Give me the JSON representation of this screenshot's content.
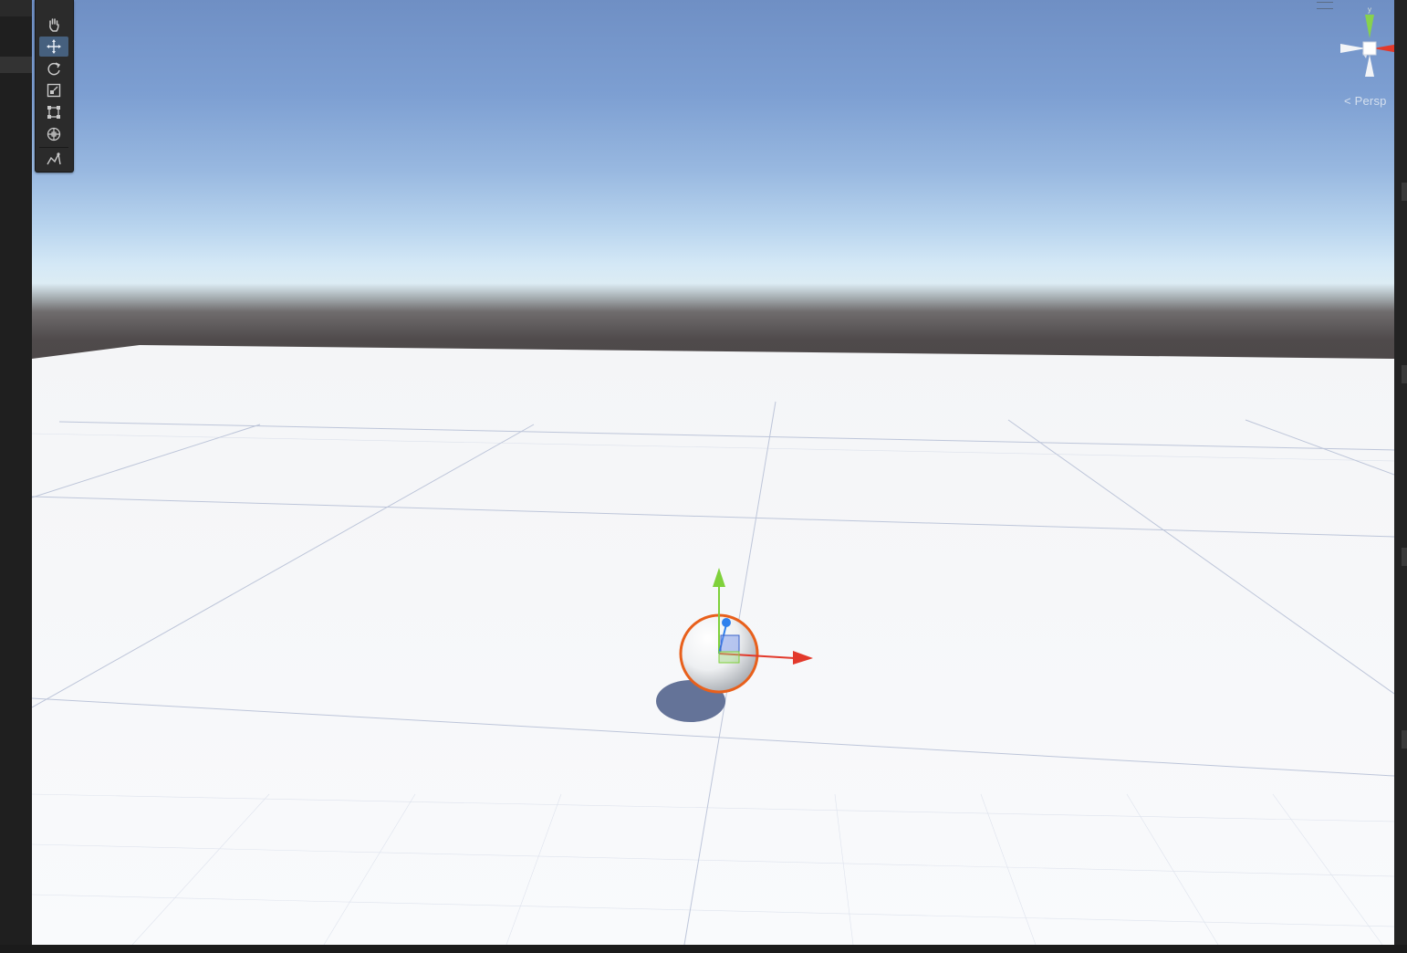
{
  "scene_view": {
    "camera_mode": "Persp",
    "gizmo_axes": {
      "x": "#e2392b",
      "y": "#87d24d",
      "z": "#4e87e6"
    }
  },
  "tools": [
    {
      "name": "hand-tool",
      "active": false
    },
    {
      "name": "move-tool",
      "active": true
    },
    {
      "name": "rotate-tool",
      "active": false
    },
    {
      "name": "scale-tool",
      "active": false
    },
    {
      "name": "rect-tool",
      "active": false
    },
    {
      "name": "transform-tool",
      "active": false
    },
    {
      "name": "custom-editor-tool",
      "active": false
    }
  ],
  "colors": {
    "selection_outline": "#e8601c",
    "move_x": "#e2392b",
    "move_y": "#7fd13b",
    "move_z": "#2f80ed",
    "toolbar_active": "#46607e"
  }
}
